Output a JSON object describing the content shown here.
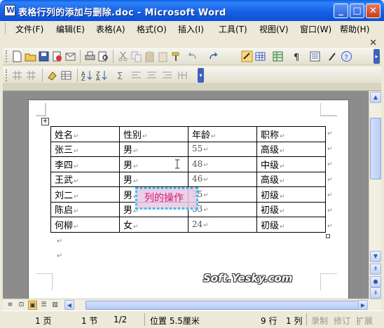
{
  "window": {
    "title": "表格行列的添加与删除.doc - Microsoft Word",
    "minimize": "_",
    "maximize": "□",
    "close": "✕"
  },
  "menu": {
    "items": [
      "文件(F)",
      "编辑(E)",
      "表格(A)",
      "格式(O)",
      "插入(I)",
      "工具(T)",
      "视图(V)",
      "窗口(W)",
      "帮助(H)"
    ],
    "doc_close": "✕"
  },
  "table": {
    "rows": [
      [
        "姓名",
        "性别",
        "年龄",
        "职称"
      ],
      [
        "张三",
        "男",
        "55",
        "高级"
      ],
      [
        "李四",
        "男",
        "48",
        "中级"
      ],
      [
        "王武",
        "男",
        "46",
        "高级"
      ],
      [
        "刘二",
        "男",
        "35",
        "初级"
      ],
      [
        "陈启",
        "男",
        "33",
        "初级"
      ],
      [
        "何柳",
        "女",
        "24",
        "初级"
      ]
    ],
    "cell_mark": "↵",
    "handle": "+"
  },
  "overlay": {
    "label": "列的操作"
  },
  "watermark": "Soft.Yesky.com",
  "scrollbar": {
    "up": "▲",
    "down": "▼",
    "prev_page": "⇞",
    "select_object": "●",
    "next_page": "⇟",
    "left": "◀",
    "right": "▶"
  },
  "status": {
    "page": "1 页",
    "section": "1 节",
    "page_of": "1/2",
    "position": "位置 5.5厘米",
    "line": "9 行",
    "column": "1 列",
    "rec": "录制",
    "trk": "修订",
    "ext": "扩展"
  },
  "colors": {
    "title_bar": "#1661e6",
    "overlay_text": "#d9167a",
    "overlay_border": "#2ec3f0",
    "overlay_fill": "#e8c8e2"
  }
}
